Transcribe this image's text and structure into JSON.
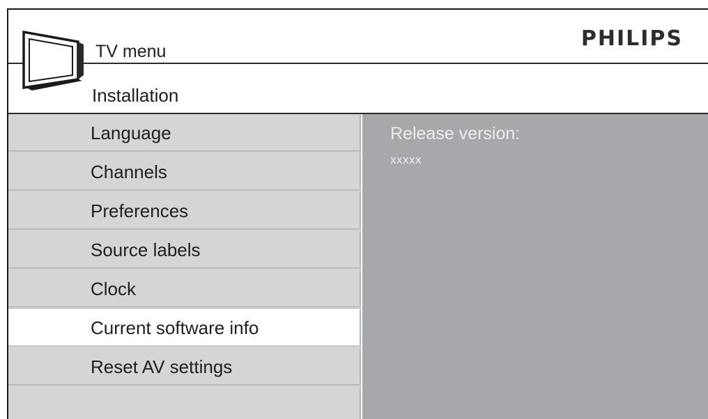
{
  "header": {
    "title": "TV menu",
    "brand": "PHILIPS"
  },
  "subheader": {
    "title": "Installation"
  },
  "menu": {
    "items": [
      {
        "label": "Language"
      },
      {
        "label": "Channels"
      },
      {
        "label": "Preferences"
      },
      {
        "label": "Source labels"
      },
      {
        "label": "Clock"
      },
      {
        "label": "Current software info"
      },
      {
        "label": "Reset AV settings"
      }
    ],
    "selected_index": 5
  },
  "panel": {
    "label": "Release version:",
    "value": "xxxxx"
  },
  "colors": {
    "menu_bg": "#d4d5d7",
    "panel_bg": "#a7a8ab",
    "selected_bg": "#ffffff",
    "text": "#1f1f1f"
  },
  "icons": {
    "tv": "tv-icon"
  }
}
